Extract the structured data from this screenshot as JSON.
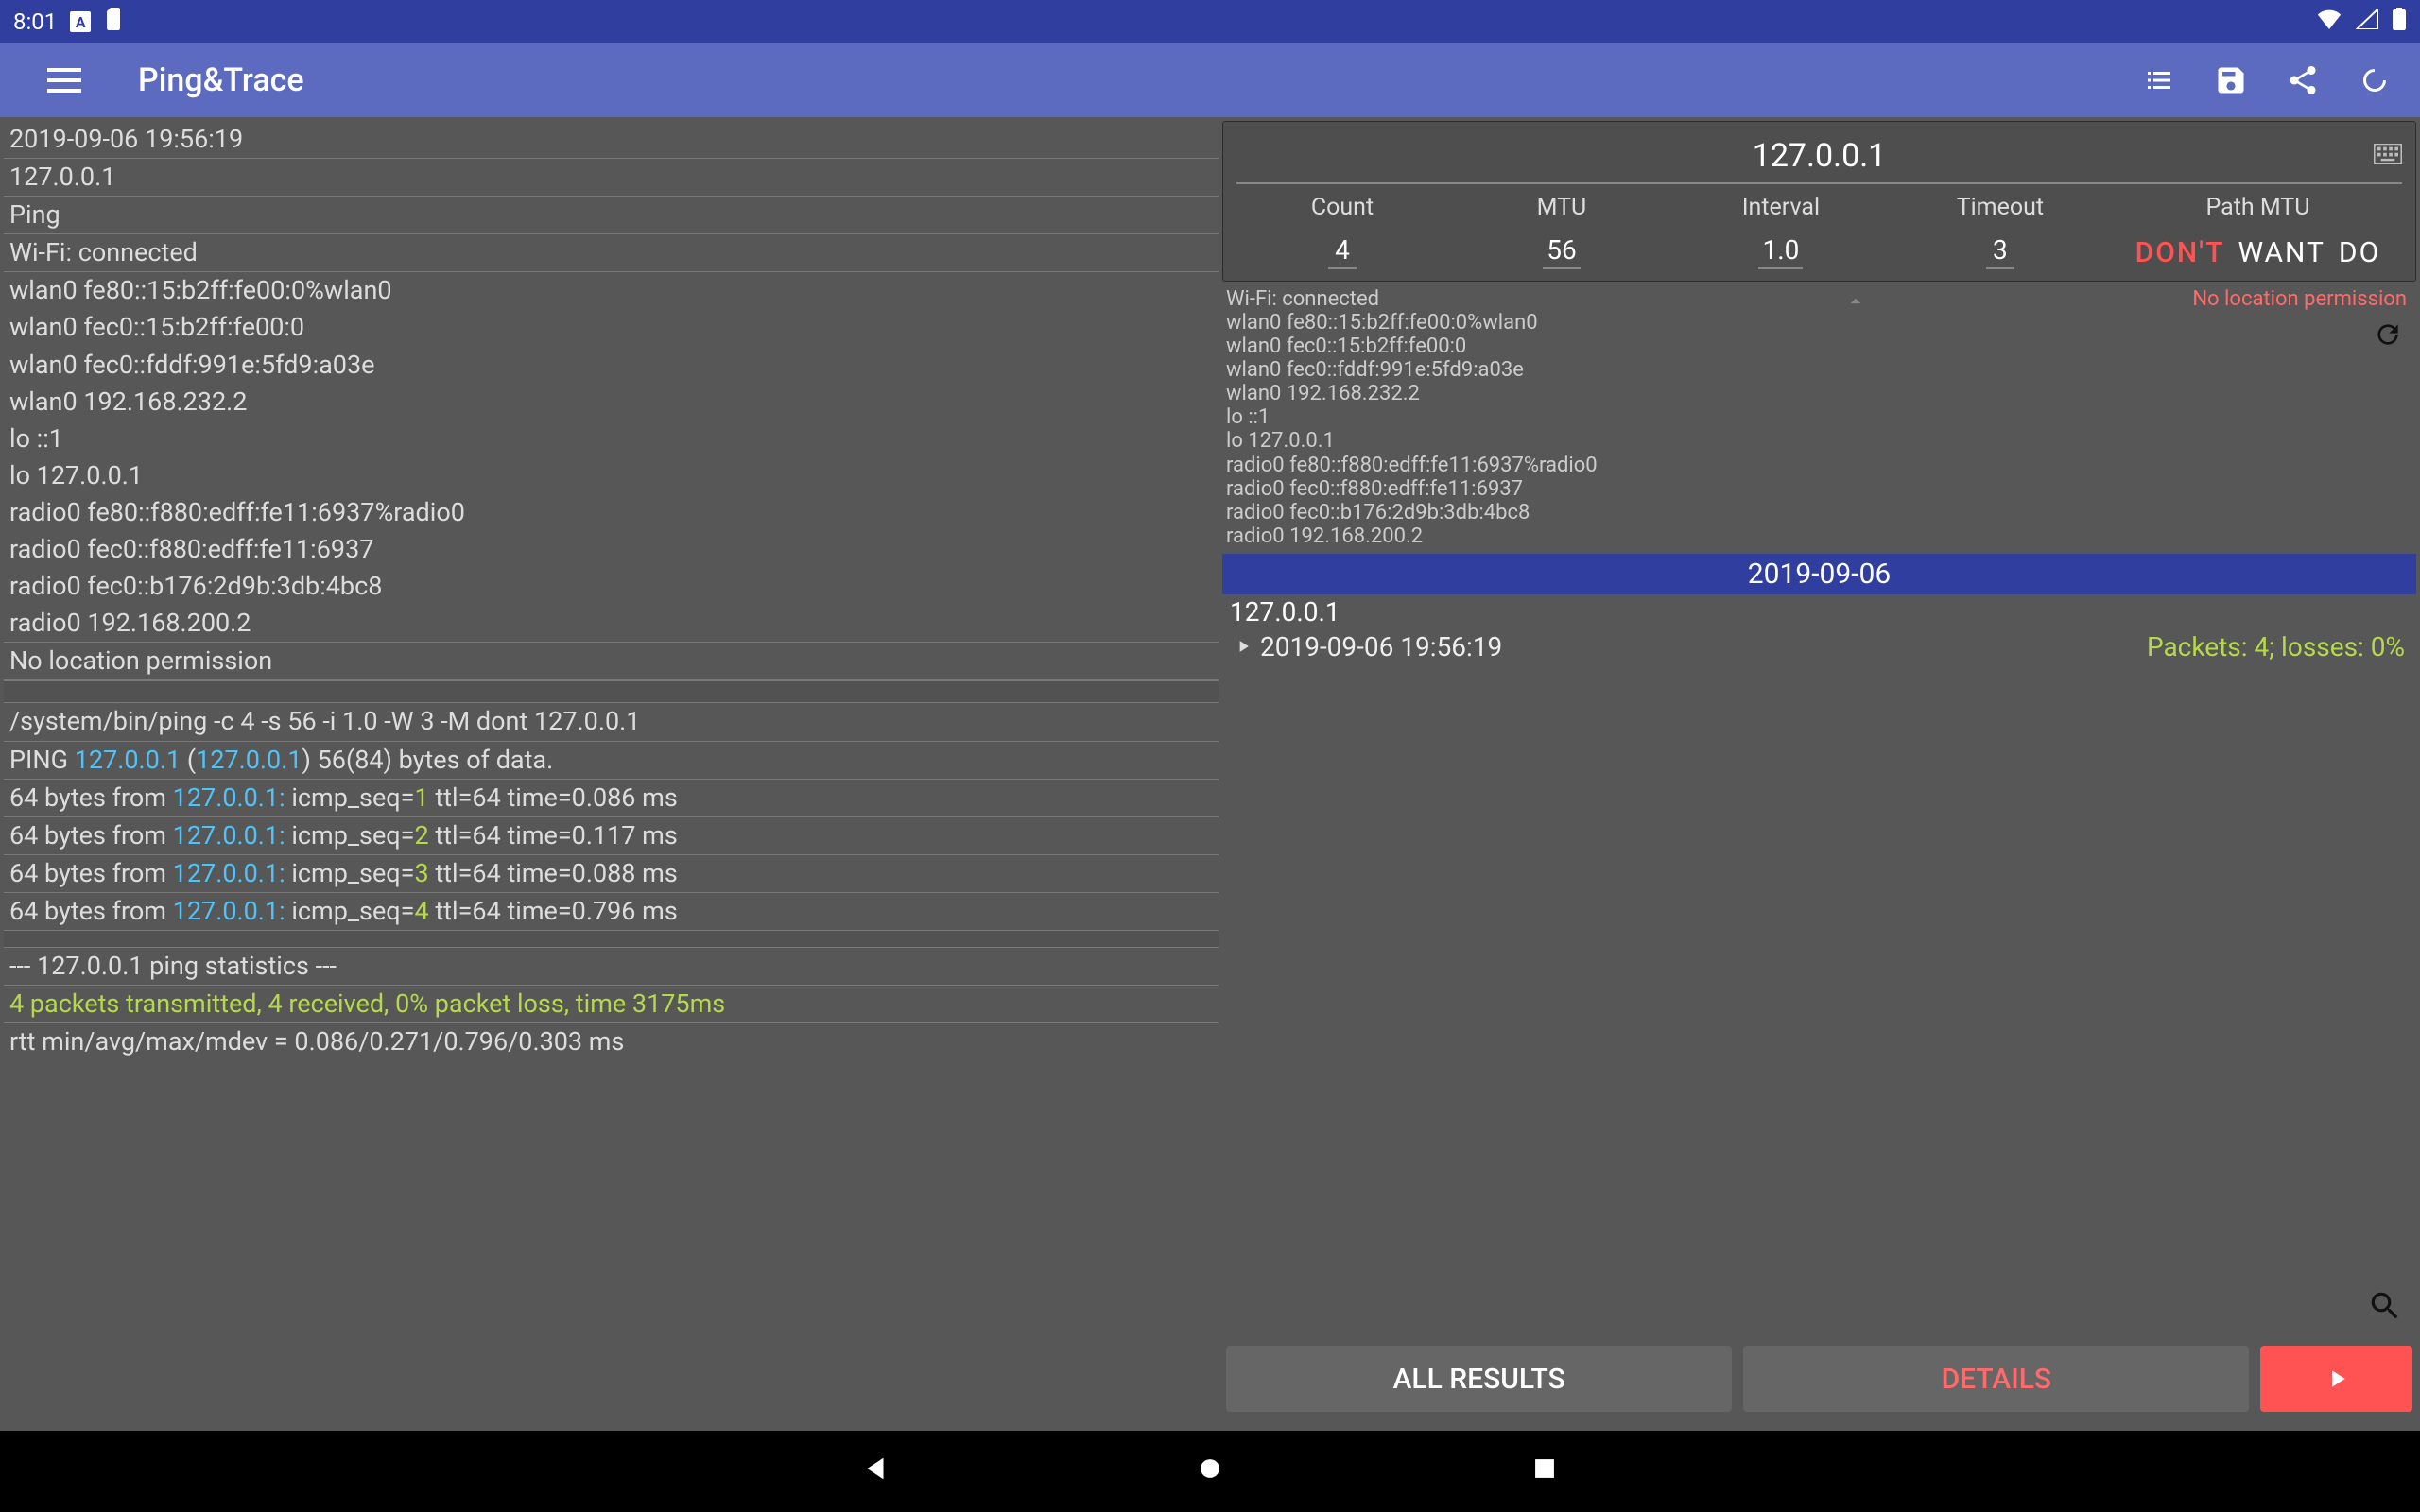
{
  "status": {
    "time": "8:01"
  },
  "appbar": {
    "title": "Ping&Trace"
  },
  "log": {
    "timestamp": "2019-09-06 19:56:19",
    "target": "127.0.0.1",
    "mode": "Ping",
    "wifi": "Wi-Fi: connected",
    "ifaces": [
      "wlan0 fe80::15:b2ff:fe00:0%wlan0",
      "wlan0 fec0::15:b2ff:fe00:0",
      "wlan0 fec0::fddf:991e:5fd9:a03e",
      "wlan0 192.168.232.2",
      "lo ::1",
      "lo 127.0.0.1",
      "radio0 fe80::f880:edff:fe11:6937%radio0",
      "radio0 fec0::f880:edff:fe11:6937",
      "radio0 fec0::b176:2d9b:3db:4bc8",
      "radio0 192.168.200.2"
    ],
    "noloc": "No location permission",
    "cmd": "/system/bin/ping  -c 4 -s 56 -i 1.0 -W 3 -M dont 127.0.0.1",
    "ping_header_pre": "PING ",
    "ping_ip1": "127.0.0.1",
    "ping_paren_open": " (",
    "ping_ip2": "127.0.0.1",
    "ping_header_post": ") 56(84) bytes of data.",
    "replies": [
      {
        "pre": "64 bytes from ",
        "ip": "127.0.0.1:",
        "mid": " icmp_seq=",
        "seq": "1",
        "post": " ttl=64 time=0.086 ms"
      },
      {
        "pre": "64 bytes from ",
        "ip": "127.0.0.1:",
        "mid": " icmp_seq=",
        "seq": "2",
        "post": " ttl=64 time=0.117 ms"
      },
      {
        "pre": "64 bytes from ",
        "ip": "127.0.0.1:",
        "mid": " icmp_seq=",
        "seq": "3",
        "post": " ttl=64 time=0.088 ms"
      },
      {
        "pre": "64 bytes from ",
        "ip": "127.0.0.1:",
        "mid": " icmp_seq=",
        "seq": "4",
        "post": " ttl=64 time=0.796 ms"
      }
    ],
    "stats_header": "--- 127.0.0.1 ping statistics ---",
    "stats_summary": "4 packets transmitted, 4 received, 0% packet loss, time 3175ms",
    "rtt": "rtt min/avg/max/mdev = 0.086/0.271/0.796/0.303 ms"
  },
  "controls": {
    "target": "127.0.0.1",
    "params": {
      "count_label": "Count",
      "count_value": "4",
      "mtu_label": "MTU",
      "mtu_value": "56",
      "interval_label": "Interval",
      "interval_value": "1.0",
      "timeout_label": "Timeout",
      "timeout_value": "3"
    },
    "pathmtu": {
      "label": "Path MTU",
      "dont": "DON'T",
      "want": "WANT",
      "do": "DO"
    }
  },
  "ifaces_small": {
    "wifi": "Wi-Fi: connected",
    "lines": [
      "wlan0 fe80::15:b2ff:fe00:0%wlan0",
      "wlan0 fec0::15:b2ff:fe00:0",
      "wlan0 fec0::fddf:991e:5fd9:a03e",
      "wlan0 192.168.232.2",
      "lo ::1",
      "lo 127.0.0.1",
      "radio0 fe80::f880:edff:fe11:6937%radio0",
      "radio0 fec0::f880:edff:fe11:6937",
      "radio0 fec0::b176:2d9b:3db:4bc8",
      "radio0 192.168.200.2"
    ],
    "noloc": "No location permission"
  },
  "results": {
    "date": "2019-09-06",
    "ip": "127.0.0.1",
    "entry_time": "2019-09-06 19:56:19",
    "entry_meta": "Packets: 4; losses: 0%"
  },
  "buttons": {
    "all": "ALL RESULTS",
    "details": "DETAILS"
  }
}
